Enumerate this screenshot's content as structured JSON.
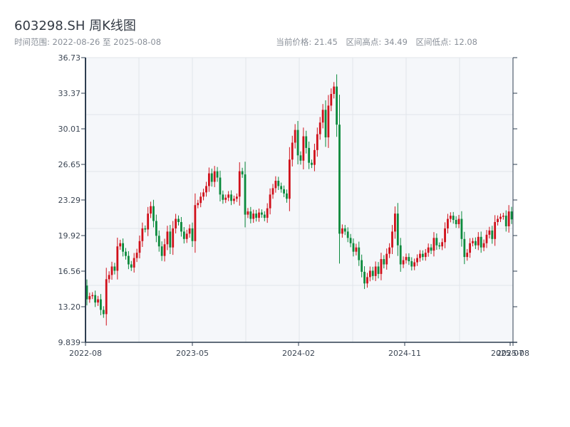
{
  "header": {
    "title": "603298.SH 周K线图",
    "range": "时间范围: 2022-08-26 至 2025-08-08",
    "current_price": "当前价格: 21.45",
    "period_high": "区间高点: 34.49",
    "period_low": "区间低点: 12.08"
  },
  "colors": {
    "up": "#d0101a",
    "down": "#0a8a3c",
    "plot_bg": "#f5f7fa",
    "axis": "#2e3e50",
    "grid": "#e1e4ea"
  },
  "chart_data": {
    "type": "candlestick",
    "title": "603298.SH 周K线图",
    "x_start": "2022-08-26",
    "x_end": "2025-08-08",
    "x_step": "weekly",
    "ylim": [
      9.839,
      36.73
    ],
    "yticks": [
      "36.73",
      "33.37",
      "30.01",
      "26.65",
      "23.29",
      "19.92",
      "16.56",
      "13.20",
      "9.839"
    ],
    "xticks": [
      "2022-08",
      "2023-05",
      "2024-02",
      "2024-11",
      "2025-07",
      "2025-08"
    ],
    "grid": true,
    "first_open": 15.2,
    "close": [
      13.9,
      14.2,
      14.3,
      13.6,
      13.9,
      12.9,
      12.5,
      15.8,
      16.2,
      17.0,
      16.6,
      18.9,
      19.2,
      18.4,
      18.0,
      17.2,
      16.9,
      17.8,
      18.3,
      19.4,
      20.6,
      20.5,
      22.0,
      22.7,
      21.3,
      19.9,
      18.9,
      18.0,
      19.1,
      20.3,
      18.8,
      20.6,
      21.5,
      21.2,
      20.3,
      19.6,
      20.1,
      20.6,
      19.4,
      22.8,
      23.0,
      23.6,
      24.0,
      24.6,
      25.8,
      25.0,
      26.0,
      25.4,
      23.8,
      23.3,
      23.5,
      23.8,
      23.2,
      23.4,
      23.6,
      26.0,
      25.7,
      21.9,
      22.2,
      21.5,
      22.0,
      21.6,
      22.1,
      21.9,
      21.6,
      22.5,
      23.8,
      24.4,
      25.1,
      24.6,
      24.3,
      23.9,
      23.4,
      27.1,
      28.7,
      29.9,
      27.5,
      27.0,
      29.3,
      28.2,
      26.8,
      26.6,
      28.0,
      29.5,
      30.6,
      31.8,
      29.2,
      32.2,
      33.3,
      34.0,
      30.4,
      20.1,
      20.6,
      20.3,
      19.7,
      19.2,
      18.4,
      18.8,
      17.6,
      16.5,
      15.4,
      16.0,
      16.6,
      16.1,
      17.0,
      16.3,
      17.7,
      17.2,
      18.2,
      18.8,
      20.3,
      22.0,
      19.0,
      17.2,
      17.6,
      17.9,
      17.5,
      17.0,
      17.4,
      17.8,
      18.2,
      17.9,
      18.3,
      18.8,
      18.5,
      19.7,
      19.0,
      18.9,
      19.3,
      20.6,
      21.5,
      21.8,
      21.4,
      21.0,
      21.5,
      19.6,
      17.9,
      18.3,
      19.2,
      19.4,
      19.0,
      19.8,
      18.8,
      19.2,
      20.0,
      20.4,
      19.6,
      21.2,
      21.5,
      21.7,
      21.8,
      20.8,
      22.2,
      21.45
    ]
  }
}
